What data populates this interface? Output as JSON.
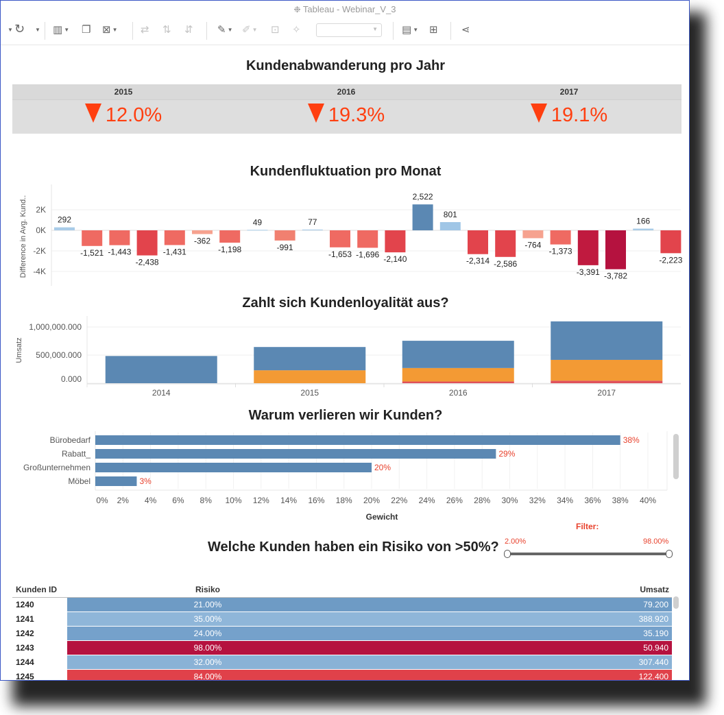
{
  "window": {
    "title": "Tableau - Webinar_V_3"
  },
  "toolbar": {
    "zoom_select": ""
  },
  "churn_per_year": {
    "title": "Kundenabwanderung pro Jahr",
    "items": [
      {
        "year": "2015",
        "value": "12.0%"
      },
      {
        "year": "2016",
        "value": "19.3%"
      },
      {
        "year": "2017",
        "value": "19.1%"
      }
    ]
  },
  "fluctuation": {
    "title": "Kundenfluktuation pro Monat",
    "ylabel": "Difference in Avg. Kund..",
    "yticks": [
      "2K",
      "0K",
      "-2K",
      "-4K"
    ]
  },
  "loyalty": {
    "title": "Zahlt sich Kundenloyalität aus?",
    "ylabel": "Umsatz",
    "yticks": [
      "1,000,000.000",
      "500,000.000",
      "0.000"
    ]
  },
  "reasons": {
    "title": "Warum verlieren wir Kunden?",
    "xlabel": "Gewicht"
  },
  "risk": {
    "title": "Welche Kunden haben ein Risiko von >50%?",
    "filter_label": "Filter:",
    "filter_min": "2.00%",
    "filter_max": "98.00%",
    "filter_min_value": 0.02,
    "filter_max_value": 0.98,
    "columns": [
      "Kunden ID",
      "Risiko",
      "Umsatz"
    ],
    "rows": [
      {
        "id": "1240",
        "risk": "21.00%",
        "sales": "79.200",
        "color": "#6e9bc5"
      },
      {
        "id": "1241",
        "risk": "35.00%",
        "sales": "388.920",
        "color": "#8fb6d9"
      },
      {
        "id": "1242",
        "risk": "24.00%",
        "sales": "35.190",
        "color": "#75a1cb"
      },
      {
        "id": "1243",
        "risk": "98.00%",
        "sales": "50.940",
        "color": "#b5123f"
      },
      {
        "id": "1244",
        "risk": "32.00%",
        "sales": "307.440",
        "color": "#8ab2d6"
      },
      {
        "id": "1245",
        "risk": "84.00%",
        "sales": "122.400",
        "color": "#e0414a"
      }
    ]
  },
  "chart_data": [
    {
      "type": "bar",
      "title": "Kundenfluktuation pro Monat",
      "ylabel": "Difference in Avg. Kund..",
      "ylim": [
        -4500,
        3000
      ],
      "values": [
        292,
        -1521,
        -1443,
        -2438,
        -1431,
        -362,
        -1198,
        49,
        -991,
        77,
        -1653,
        -1696,
        -2140,
        2522,
        801,
        -2314,
        -2586,
        -764,
        -1373,
        -3391,
        -3782,
        166,
        -2223
      ],
      "labels": [
        "292",
        "-1,521",
        "-1,443",
        "-2,438",
        "-1,431",
        "-362",
        "-1,198",
        "49",
        "-991",
        "77",
        "-1,653",
        "-1,696",
        "-2,140",
        "2,522",
        "801",
        "-2,314",
        "-2,586",
        "-764",
        "-1,373",
        "-3,391",
        "-3,782",
        "166",
        "-2,223"
      ],
      "colors": [
        "#a9cce8",
        "#ef6a62",
        "#ef6a62",
        "#e2444c",
        "#ef6a62",
        "#f6a28f",
        "#ef6a62",
        "#a9cce8",
        "#f18070",
        "#a9cce8",
        "#ef6a62",
        "#ef6a62",
        "#e2444c",
        "#5b88b3",
        "#a0c6e6",
        "#e2444c",
        "#e2444c",
        "#f6a28f",
        "#ef6a62",
        "#c01a3f",
        "#b5123f",
        "#a9cce8",
        "#e2444c"
      ]
    },
    {
      "type": "bar",
      "stacked": true,
      "title": "Zahlt sich Kundenloyalität aus?",
      "ylabel": "Umsatz",
      "ylim": [
        0,
        1100000
      ],
      "categories": [
        "2014",
        "2015",
        "2016",
        "2017"
      ],
      "series": [
        {
          "values": [
            0,
            0,
            30000,
            45000
          ],
          "color": "#e0515a"
        },
        {
          "values": [
            0,
            230000,
            240000,
            370000
          ],
          "color": "#f39a34"
        },
        {
          "values": [
            484000,
            414000,
            485000,
            685000
          ],
          "color": "#5b88b3"
        }
      ]
    },
    {
      "type": "bar",
      "orientation": "horizontal",
      "title": "Warum verlieren wir Kunden?",
      "xlabel": "Gewicht",
      "categories": [
        "Bürobedarf",
        "Rabatt_",
        "Großunternehmen",
        "Möbel"
      ],
      "values": [
        38,
        29,
        20,
        3
      ],
      "labels": [
        "38%",
        "29%",
        "20%",
        "3%"
      ],
      "xticks": [
        "0%",
        "2%",
        "4%",
        "6%",
        "8%",
        "10%",
        "12%",
        "14%",
        "16%",
        "18%",
        "20%",
        "22%",
        "24%",
        "26%",
        "28%",
        "30%",
        "32%",
        "34%",
        "36%",
        "38%",
        "40%"
      ],
      "xlim": [
        0,
        41.5
      ]
    }
  ]
}
